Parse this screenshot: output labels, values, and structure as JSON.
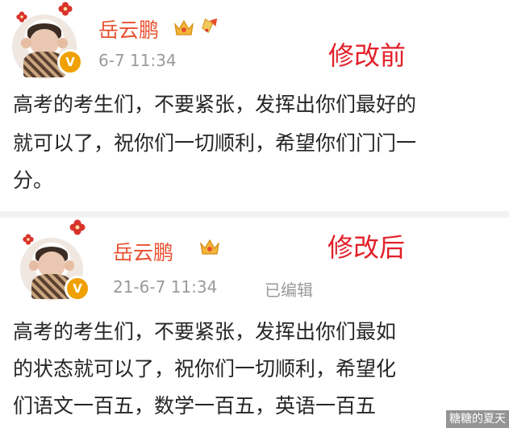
{
  "before": {
    "annotation": "修改前",
    "username": "岳云鹏",
    "timestamp": "6-7 11:34",
    "lines": [
      "高考的考生们，不要紧张，发挥出你们最好的",
      "就可以了，祝你们一切顺利，希望你们门门一",
      "分。"
    ]
  },
  "after": {
    "annotation": "修改后",
    "username": "岳云鹏",
    "timestamp": "21-6-7 11:34",
    "edited_label": "已编辑",
    "lines": [
      "高考的考生们，不要紧张，发挥出你们最如",
      "的状态就可以了，祝你们一切顺利，希望化",
      "们语文一百五，数学一百五，英语一百五"
    ]
  },
  "watermark": "糖糖的夏天",
  "colors": {
    "username": "#e8502f",
    "annotation": "#e2202a",
    "timestamp": "#9a9a9a",
    "text": "#262626",
    "badge": "#f0a000"
  },
  "icons": [
    "avatar",
    "flower-icon",
    "verified-badge-icon",
    "crown-icon",
    "bell-icon"
  ]
}
